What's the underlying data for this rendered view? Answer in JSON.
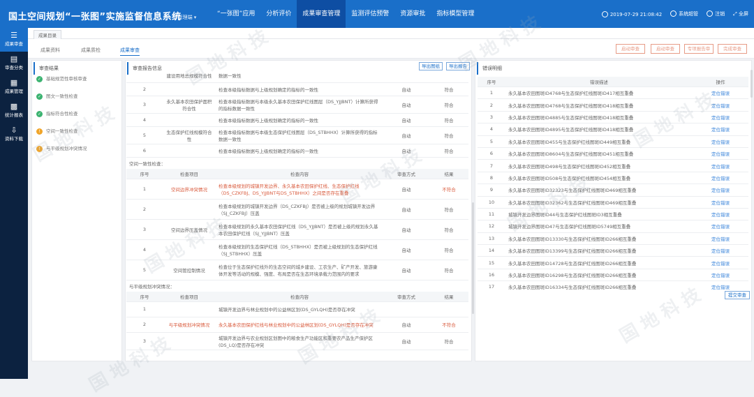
{
  "header": {
    "title": "国土空间规划“一张图”实施监督信息系统",
    "tenant": "| 管理端 ▾",
    "nav": [
      "“一张图”应用",
      "分析评价",
      "成果审查管理",
      "监测评估预警",
      "资源审批",
      "指标模型管理"
    ],
    "active_nav": 2,
    "datetime": "2019-07-29  21:08:42",
    "user": "系统超管",
    "logout": "注销",
    "fullscreen": "全屏"
  },
  "sidebar": [
    {
      "icon": "☰",
      "label": "成果审查"
    },
    {
      "icon": "▤",
      "label": "审查分类"
    },
    {
      "icon": "▦",
      "label": "成果管理"
    },
    {
      "icon": "▩",
      "label": "统计报表"
    },
    {
      "icon": "⇩",
      "label": "资料下载"
    }
  ],
  "tab": "成果目录",
  "subtabs": [
    "成果资料",
    "成果质检",
    "成果审查"
  ],
  "toolbar": [
    "启动审查",
    "启动审查",
    "专项报告审",
    "完成审查"
  ],
  "results": {
    "title": "审查结果",
    "items": [
      {
        "status": "ok",
        "label": "基础规范性审核审查"
      },
      {
        "status": "ok",
        "label": "图文一致性检查"
      },
      {
        "status": "ok",
        "label": "指标符合性检查"
      },
      {
        "status": "warn",
        "label": "空间一致性检查"
      },
      {
        "status": "warn",
        "label": "与平级规划冲突情况"
      }
    ]
  },
  "report": {
    "title": "审查报告信息",
    "export_doc": "导出图纸",
    "export_report": "导出报告",
    "table1": [
      {
        "no": "",
        "item": "建设用地总规模符合性",
        "content": "数据一致性",
        "mode": "",
        "result": ""
      },
      {
        "no": "2",
        "item": "",
        "content": "检查本级指标数据与上级规划确定的指标的一致性",
        "mode": "自动",
        "result": "符合"
      },
      {
        "no": "3",
        "item": "永久基本农田保护面积符合性",
        "content": "检查本级指标数据与本级永久基本农田保护红线图层（DS_YJJBNT）计算所获得的指标数据一致性",
        "mode": "自动",
        "result": "符合"
      },
      {
        "no": "4",
        "item": "",
        "content": "检查本级指标数据与上级规划确定的指标的一致性",
        "mode": "自动",
        "result": "符合"
      },
      {
        "no": "5",
        "item": "生态保护红线规模符合性",
        "content": "检查本级指标数据与本级生态保护红线图层（DS_STBHHX）计算所获得的指标数据一致性",
        "mode": "自动",
        "result": "符合"
      },
      {
        "no": "6",
        "item": "",
        "content": "检查本级指标数据与上级规划确定的指标的一致性",
        "mode": "自动",
        "result": "符合"
      }
    ],
    "sect2": "空间一致性检查：",
    "headers": [
      "序号",
      "检查项目",
      "检查内容",
      "审查方式",
      "结果"
    ],
    "table2": [
      {
        "no": "1",
        "item": "空间边界冲突情况",
        "content": "检查本级规划的城镇开发边界、永久基本农田保护红线、生态保护红线（DS_CZKFBJ、DS_YJJBNT与DS_STBHHX）之间是否存在重叠",
        "mode": "自动",
        "result": "不符合",
        "bad": true
      },
      {
        "no": "2",
        "item": "",
        "content": "检查本级规划的城镇开发边界（DS_CZKFBJ）是否被上级的规划城镇开发边界（SJ_CZKFBJ）压盖",
        "mode": "自动",
        "result": "符合",
        "bad": false
      },
      {
        "no": "3",
        "item": "空间边界压盖情况",
        "content": "检查本级规划的永久基本农田保护红线（DS_YJJBNT）是否被上级的规划永久基本农田保护红线（SJ_YJJBNT）压盖",
        "mode": "自动",
        "result": "符合",
        "bad": false
      },
      {
        "no": "4",
        "item": "",
        "content": "检查本级规划的生态保护红线（DS_STBHHX）是否被上级规划的生态保护红线（SJ_STBHHX）压盖",
        "mode": "自动",
        "result": "符合",
        "bad": false
      },
      {
        "no": "5",
        "item": "空间管控制情况",
        "content": "检查位于生态保护红线外的生态空间的城乡建设、工农生产、矿产开发、旅游康体开发等活动的规模、强度、布局是否在生态环境承载力范围内的要求",
        "mode": "自动",
        "result": "符合",
        "bad": false
      }
    ],
    "sect3": "与平级规划冲突情况：",
    "table3": [
      {
        "no": "1",
        "item": "",
        "content": "城镇开发边界与林业规划中的公益林区划(DS_GYLQH)是否存在冲突",
        "mode": "",
        "result": "",
        "bad": false
      },
      {
        "no": "2",
        "item": "与平级规划冲突情况",
        "content": "永久基本农田保护红线与林业规划中的公益林区划(DS_GYLQH)是否存在冲突",
        "mode": "自动",
        "result": "不符合",
        "bad": true
      },
      {
        "no": "3",
        "item": "",
        "content": "城镇开发边界与农业规划区划图中的粮食生产功能区和重要农产品生产保护区(DS_LQ)是否存在冲突",
        "mode": "自动",
        "result": "符合",
        "bad": false
      }
    ]
  },
  "errors": {
    "title": "错误明细",
    "headers": [
      "序号",
      "错误描述",
      "操作"
    ],
    "action": "定位错误",
    "submit": "提交审查",
    "rows": [
      "永久基本农田图斑ID4768与生态保护红线图斑ID417相互重叠",
      "永久基本农田图斑ID4768与生态保护红线图斑ID418相互重叠",
      "永久基本农田图斑ID4885与生态保护红线图斑ID418相互重叠",
      "永久基本农田图斑ID4895与生态保护红线图斑ID418相互重叠",
      "永久基本农田图斑ID455与生态保护红线图斑ID449相互重叠",
      "永久基本农田图斑ID8604与生态保护红线图斑ID451相互重叠",
      "永久基本农田图斑ID498与生态保护红线图斑ID452相互重叠",
      "永久基本农田图斑ID508与生态保护红线图斑ID454相互重叠",
      "永久基本农田图斑ID32323与生态保护红线图斑ID469相互重叠",
      "永久基本农田图斑ID32362与生态保护红线图斑ID469相互重叠",
      "城镇开发边界图斑ID44与生态保护红线图斑ID3相互重叠",
      "城镇开发边界图斑ID47与生态保护红线图斑ID5749相互重叠",
      "永久基本农田图斑ID13330与生态保护红线图斑ID266相互重叠",
      "永久基本农田图斑ID13399与生态保护红线图斑ID266相互重叠",
      "永久基本农田图斑ID14728与生态保护红线图斑ID266相互重叠",
      "永久基本农田图斑ID16298与生态保护红线图斑ID266相互重叠",
      "永久基本农田图斑ID16334与生态保护红线图斑ID266相互重叠"
    ]
  },
  "watermark": "国地科技"
}
